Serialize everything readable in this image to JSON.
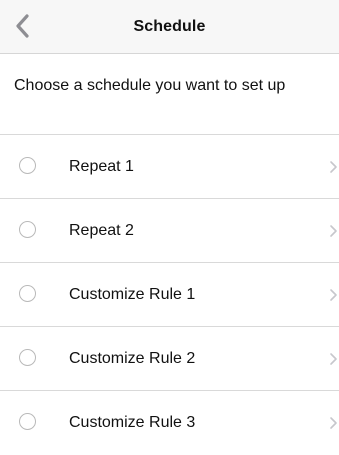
{
  "nav": {
    "title": "Schedule",
    "back_icon": "chevron-left-icon"
  },
  "prompt": {
    "text": "Choose a schedule you want to set up"
  },
  "options": [
    {
      "label": "Repeat 1",
      "selected": false
    },
    {
      "label": "Repeat 2",
      "selected": false
    },
    {
      "label": "Customize Rule 1",
      "selected": false
    },
    {
      "label": "Customize Rule 2",
      "selected": false
    },
    {
      "label": "Customize Rule 3",
      "selected": false
    }
  ],
  "colors": {
    "nav_background": "#f7f7f7",
    "divider": "#d9d9d9",
    "radio_border": "#b9b9b9",
    "chevron": "#c7c7cc",
    "back_chevron": "#8e8e93"
  }
}
